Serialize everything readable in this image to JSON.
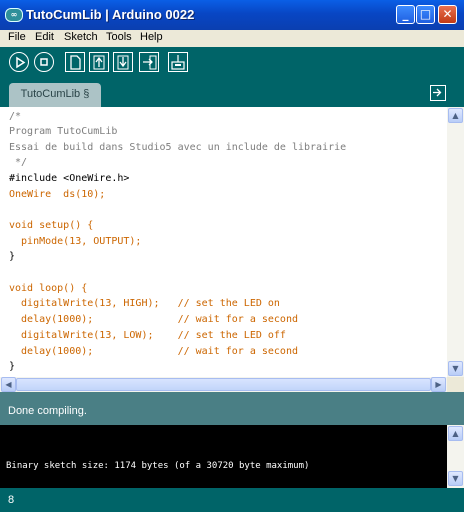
{
  "window": {
    "title": "TutoCumLib | Arduino 0022",
    "app_icon": "arduino-icon"
  },
  "menu": [
    "File",
    "Edit",
    "Sketch",
    "Tools",
    "Help"
  ],
  "toolbar": {
    "buttons": [
      "verify-icon",
      "stop-icon",
      "new-file-icon",
      "open-icon",
      "save-icon",
      "upload-icon",
      "serial-monitor-icon"
    ]
  },
  "tabs": [
    {
      "label": "TutoCumLib §"
    }
  ],
  "code": {
    "lines": [
      "/*",
      "Program TutoCumLib",
      "Essai de build dans Studio5 avec un include de librairie",
      " */",
      "#include <OneWire.h>",
      "OneWire  ds(10);",
      "",
      "void setup() {",
      "  pinMode(13, OUTPUT);",
      "}",
      "",
      "void loop() {",
      "  digitalWrite(13, HIGH);   // set the LED on",
      "  delay(1000);              // wait for a second",
      "  digitalWrite(13, LOW);    // set the LED off",
      "  delay(1000);              // wait for a second",
      "}"
    ]
  },
  "status": {
    "message": "Done compiling."
  },
  "console": {
    "output": "Binary sketch size: 1174 bytes (of a 30720 byte maximum)"
  },
  "footer": {
    "line_number": "8"
  },
  "colors": {
    "toolbar": "#006468",
    "status": "#4a7f85",
    "keyword": "#cc6600",
    "constant": "#006699",
    "comment": "#7e7e7e"
  }
}
